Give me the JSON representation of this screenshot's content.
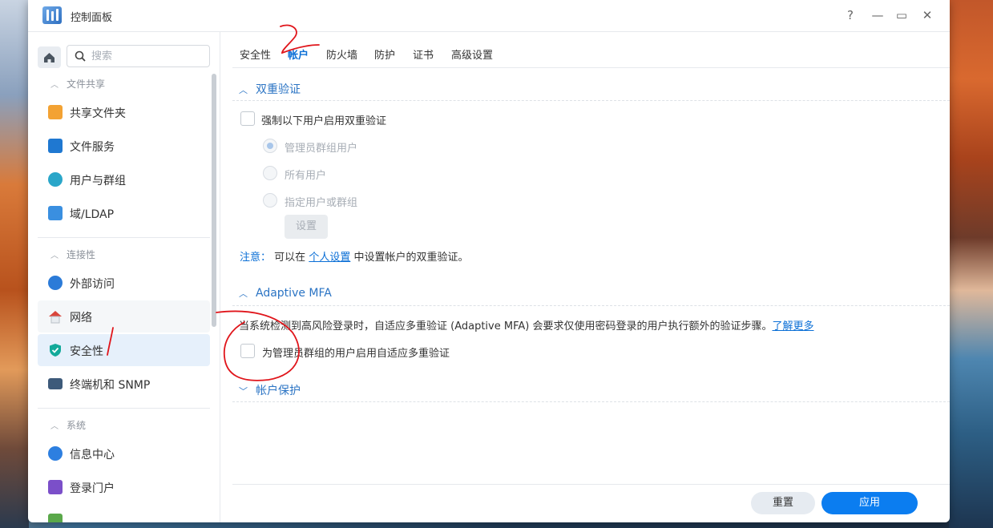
{
  "window": {
    "title": "控制面板",
    "help": "?",
    "minimize": "—",
    "maximize": "▭",
    "close": "✕"
  },
  "sidebar": {
    "search_placeholder": "搜索",
    "sections": {
      "file_sharing": "文件共享",
      "connectivity": "连接性",
      "system": "系统"
    },
    "items": [
      {
        "label": "共享文件夹",
        "icon": "shared-folder-icon",
        "color": "#f3a233"
      },
      {
        "label": "文件服务",
        "icon": "file-services-icon",
        "color": "#1f78d1"
      },
      {
        "label": "用户与群组",
        "icon": "users-groups-icon",
        "color": "#2aa6c9"
      },
      {
        "label": "域/LDAP",
        "icon": "domain-ldap-icon",
        "color": "#3a8fe0"
      },
      {
        "label": "外部访问",
        "icon": "external-access-icon",
        "color": "#2b7bd8"
      },
      {
        "label": "网络",
        "icon": "network-icon",
        "color": "#d9453b"
      },
      {
        "label": "安全性",
        "icon": "security-shield-icon",
        "color": "#12a99a"
      },
      {
        "label": "终端机和 SNMP",
        "icon": "terminal-icon",
        "color": "#3d5a7a"
      },
      {
        "label": "信息中心",
        "icon": "info-center-icon",
        "color": "#2d7fe0"
      },
      {
        "label": "登录门户",
        "icon": "login-portal-icon",
        "color": "#7b4fc9"
      }
    ]
  },
  "tabs": [
    "安全性",
    "帐户",
    "防火墙",
    "防护",
    "证书",
    "高级设置"
  ],
  "two_factor": {
    "header": "双重验证",
    "enforce_label": "强制以下用户启用双重验证",
    "options": [
      "管理员群组用户",
      "所有用户",
      "指定用户或群组"
    ],
    "settings_button": "设置",
    "note_key": "注意：",
    "note_before": "可以在",
    "note_link": "个人设置",
    "note_after": "中设置帐户的双重验证。"
  },
  "adaptive_mfa": {
    "header": "Adaptive MFA",
    "description": "当系统检测到高风险登录时，自适应多重验证 (Adaptive MFA) 会要求仅使用密码登录的用户执行额外的验证步骤。",
    "learn_more": "了解更多",
    "enable_label": "为管理员群组的用户启用自适应多重验证"
  },
  "account_protection": {
    "header": "帐户保护"
  },
  "footer": {
    "reset": "重置",
    "apply": "应用"
  },
  "colors": {
    "accent": "#0b7df0",
    "link": "#0b6fd6",
    "section_header": "#2b74c4",
    "annotation_ink": "#e0151b"
  }
}
